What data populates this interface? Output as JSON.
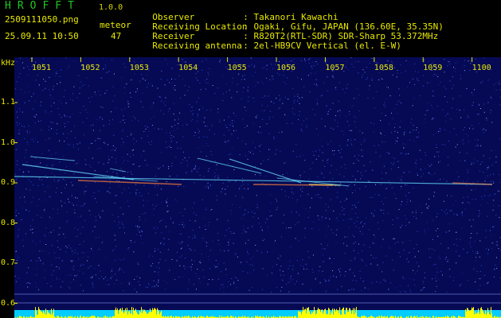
{
  "header": {
    "app_title": "HROFFT",
    "app_version": "1.0.0",
    "file_name": "2509111050.png",
    "meteor_label": "meteor",
    "timestamp": "25.09.11 10:50",
    "meteor_count": "47"
  },
  "info": [
    {
      "label": "Observer",
      "value": ": Takanori Kawachi"
    },
    {
      "label": "Receiving Location",
      "value": ": Ogaki, Gifu, JAPAN (136.60E, 35.35N)"
    },
    {
      "label": "Receiver",
      "value": ": R820T2(RTL-SDR) SDR-Sharp 53.372MHz"
    },
    {
      "label": "Receiving antenna",
      "value": ": 2el-HB9CV Vertical (el. E-W)"
    }
  ],
  "axes": {
    "y_unit": "kHz",
    "x_ticks": [
      "1051",
      "1052",
      "1053",
      "1054",
      "1055",
      "1056",
      "1057",
      "1058",
      "1059",
      "1100"
    ],
    "y_ticks": [
      "1.1",
      "1.0",
      "0.9",
      "0.8",
      "0.7",
      "0.6"
    ]
  },
  "colors": {
    "background": "#000000",
    "plot_background": "#060a55",
    "label_text": "#e8e800",
    "title_green": "#1ec81e",
    "noise_band": "#00ccff",
    "noise_peak": "#ffff00",
    "trail": "#66e0ff",
    "trail_hot": "#ff8040"
  }
}
